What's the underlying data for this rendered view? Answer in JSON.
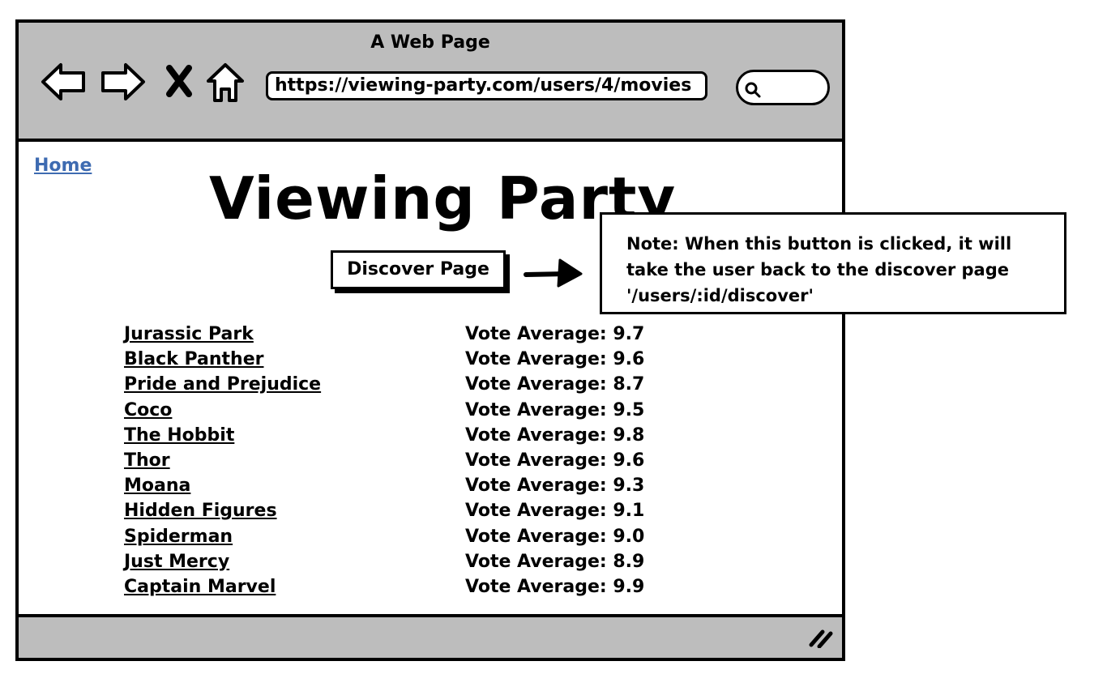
{
  "window": {
    "title": "A Web Page",
    "url": "https://viewing-party.com/users/4/movies"
  },
  "toolbar": {
    "back_icon": "back-arrow-icon",
    "forward_icon": "forward-arrow-icon",
    "stop_icon": "close-icon",
    "home_icon": "home-icon",
    "search_icon": "search-icon"
  },
  "page": {
    "home_link": "Home",
    "title": "Viewing Party",
    "discover_button": "Discover Page"
  },
  "movies": [
    {
      "title": "Jurassic Park",
      "vote": "Vote Average: 9.7"
    },
    {
      "title": "Black Panther",
      "vote": "Vote Average: 9.6"
    },
    {
      "title": "Pride and Prejudice",
      "vote": "Vote Average: 8.7"
    },
    {
      "title": "Coco",
      "vote": "Vote Average: 9.5"
    },
    {
      "title": "The Hobbit",
      "vote": "Vote Average: 9.8"
    },
    {
      "title": "Thor",
      "vote": "Vote Average: 9.6"
    },
    {
      "title": "Moana",
      "vote": "Vote Average: 9.3"
    },
    {
      "title": "Hidden Figures",
      "vote": "Vote Average: 9.1"
    },
    {
      "title": "Spiderman",
      "vote": "Vote Average: 9.0"
    },
    {
      "title": "Just Mercy",
      "vote": "Vote Average: 8.9"
    },
    {
      "title": "Captain Marvel",
      "vote": "Vote Average: 9.9"
    }
  ],
  "annotation": {
    "note_text": "Note: When this button is clicked, it will take the user back to the discover page '/users/:id/discover'"
  },
  "colors": {
    "chrome_gray": "#bdbdbd",
    "link_blue": "#3e6bb1"
  }
}
